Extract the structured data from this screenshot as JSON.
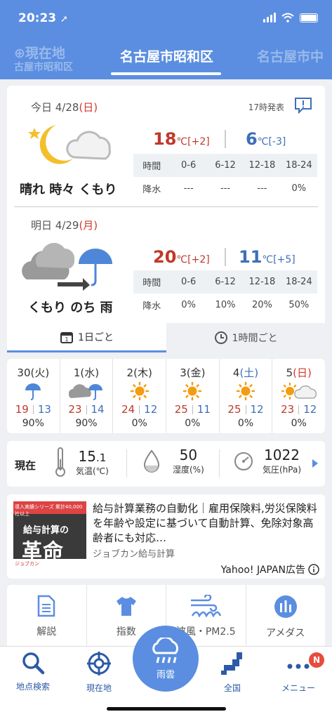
{
  "status": {
    "time": "20:23"
  },
  "tabs": {
    "left_top": "現在地",
    "left_sub": "古屋市昭和区",
    "active": "名古屋市昭和区",
    "right": "名古屋市中"
  },
  "today": {
    "date_prefix": "今日 4/28",
    "weekday": "(日)",
    "issued": "17時発表",
    "condition": "晴れ 時々 くもり",
    "max": "18",
    "max_unit": "℃",
    "max_diff": "[+2]",
    "min": "6",
    "min_unit": "℃",
    "min_diff": "[-3]",
    "precip_header": [
      "時間",
      "0-6",
      "6-12",
      "12-18",
      "18-24"
    ],
    "precip_values": [
      "降水",
      "---",
      "---",
      "---",
      "0%"
    ]
  },
  "tomorrow": {
    "date_prefix": "明日 4/29",
    "weekday": "(月)",
    "condition": "くもり のち 雨",
    "max": "20",
    "max_unit": "℃",
    "max_diff": "[+2]",
    "min": "11",
    "min_unit": "℃",
    "min_diff": "[+5]",
    "precip_header": [
      "時間",
      "0-6",
      "6-12",
      "12-18",
      "18-24"
    ],
    "precip_values": [
      "降水",
      "0%",
      "10%",
      "20%",
      "50%"
    ]
  },
  "subtabs": {
    "daily": "1日ごと",
    "hourly": "1時間ごと"
  },
  "week": [
    {
      "day": "30",
      "wd": "(火)",
      "wd_color": "",
      "icon": "umbrella-icon",
      "hi": "19",
      "lo": "13",
      "pop": "90%"
    },
    {
      "day": "1",
      "wd": "(水)",
      "wd_color": "",
      "icon": "cloud-umbrella-icon",
      "hi": "23",
      "lo": "14",
      "pop": "90%"
    },
    {
      "day": "2",
      "wd": "(木)",
      "wd_color": "",
      "icon": "sun-icon",
      "hi": "24",
      "lo": "12",
      "pop": "0%"
    },
    {
      "day": "3",
      "wd": "(金)",
      "wd_color": "",
      "icon": "sun-icon",
      "hi": "25",
      "lo": "11",
      "pop": "0%"
    },
    {
      "day": "4",
      "wd": "(土)",
      "wd_color": "blue",
      "icon": "sun-icon",
      "hi": "25",
      "lo": "12",
      "pop": "0%"
    },
    {
      "day": "5",
      "wd": "(日)",
      "wd_color": "red",
      "icon": "sun-cloud-icon",
      "hi": "23",
      "lo": "12",
      "pop": "0%"
    }
  ],
  "now": {
    "label": "現在",
    "temp": "15",
    "temp_dec": ".1",
    "temp_label": "気温(℃)",
    "humidity": "50",
    "humidity_label": "湿度(%)",
    "pressure": "1022",
    "pressure_label": "気圧(hPa)"
  },
  "ad": {
    "img_top": "導入実績シリーズ 累計40,000社以上",
    "img_line1": "給与計算の",
    "img_line2": "革命",
    "img_bottom": "ジョブカン",
    "title": "給与計算業務の自動化｜雇用保険料,労災保険料を年齢や設定に基づいて自動計算、免除対象高齢者にも対応…",
    "sponsor": "ジョブカン給与計算",
    "label": "Yahoo! JAPAN広告"
  },
  "grid": [
    "解説",
    "指数",
    "波風・PM2.5",
    "アメダス"
  ],
  "tabbar": {
    "search": "地点検索",
    "location": "現在地",
    "rain": "雨雲",
    "country": "全国",
    "menu": "メニュー",
    "badge": "N"
  },
  "colors": {
    "accent": "#5b8ee0",
    "hot": "#c0392b",
    "cold": "#3e6fb8"
  }
}
